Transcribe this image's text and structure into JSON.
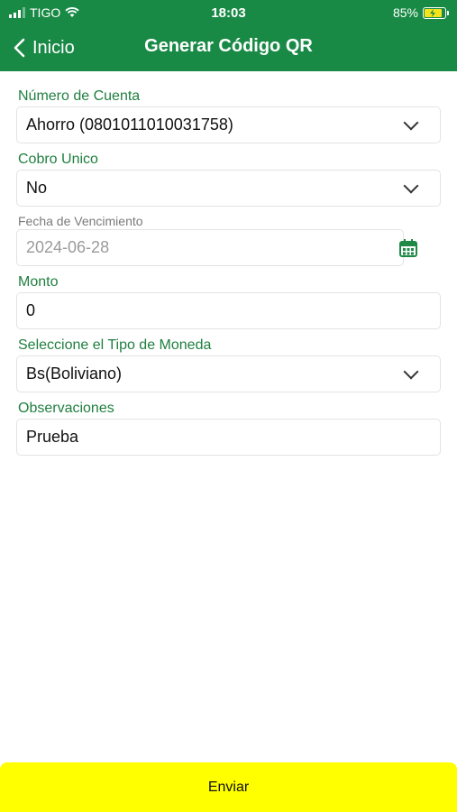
{
  "status_bar": {
    "carrier": "TIGO",
    "time": "18:03",
    "battery": "85%"
  },
  "nav": {
    "back_label": "Inicio",
    "title": "Generar Código QR"
  },
  "form": {
    "cuenta": {
      "label": "Número de Cuenta",
      "value": "Ahorro (0801011010031758)"
    },
    "cobro": {
      "label": "Cobro Unico",
      "value": "No"
    },
    "fecha": {
      "label": "Fecha de Vencimiento",
      "value": "2024-06-28"
    },
    "monto": {
      "label": "Monto",
      "value": "0"
    },
    "moneda": {
      "label": "Seleccione el Tipo de Moneda",
      "value": "Bs(Boliviano)"
    },
    "observaciones": {
      "label": "Observaciones",
      "value": "Prueba"
    }
  },
  "submit_label": "Enviar",
  "colors": {
    "header": "#198a46",
    "label": "#1f7f3f",
    "button": "#ffff00"
  },
  "icons": [
    "signal-icon",
    "wifi-icon",
    "battery-icon",
    "chevron-left-icon",
    "chevron-down-icon",
    "calendar-icon"
  ]
}
